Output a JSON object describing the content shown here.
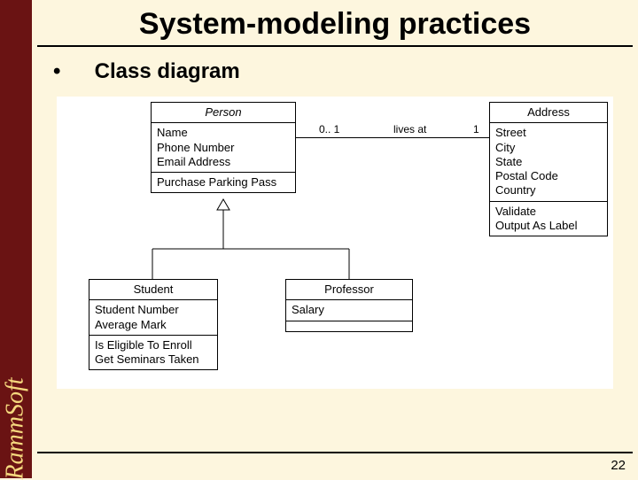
{
  "brand": "RammSoft",
  "title": "System-modeling practices",
  "bullet": {
    "marker": "•",
    "text": "Class diagram"
  },
  "page_number": "22",
  "diagram": {
    "person": {
      "name": "Person",
      "attrs": [
        "Name",
        "Phone Number",
        "Email Address"
      ],
      "ops": [
        "Purchase Parking Pass"
      ]
    },
    "address": {
      "name": "Address",
      "attrs": [
        "Street",
        "City",
        "State",
        "Postal Code",
        "Country"
      ],
      "ops": [
        "Validate",
        "Output As Label"
      ]
    },
    "student": {
      "name": "Student",
      "attrs": [
        "Student Number",
        "Average Mark"
      ],
      "ops": [
        "Is Eligible To Enroll",
        "Get Seminars Taken"
      ]
    },
    "professor": {
      "name": "Professor",
      "attrs": [
        "Salary"
      ]
    },
    "assoc": {
      "mult_left": "0.. 1",
      "label": "lives at",
      "mult_right": "1"
    }
  }
}
